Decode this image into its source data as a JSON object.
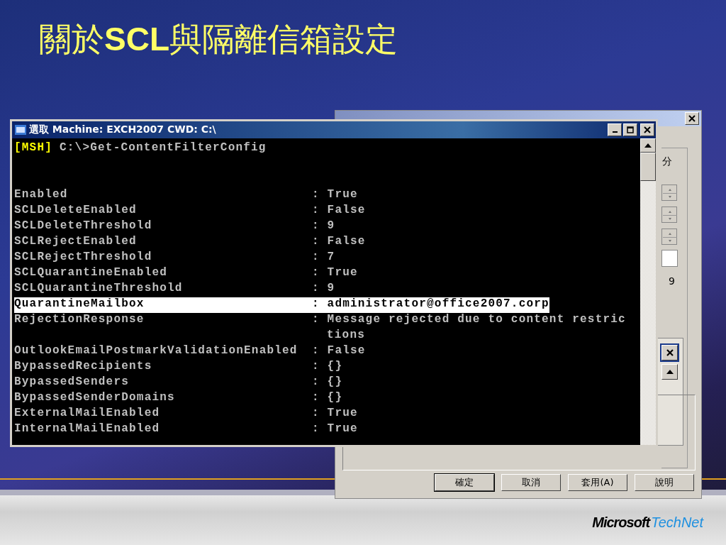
{
  "slide": {
    "title": "關於**SCL**與隔離信箱設定"
  },
  "dialog": {
    "fragments": [
      "分",
      "9"
    ],
    "buttons": [
      {
        "label": "確定",
        "default": true
      },
      {
        "label": "取消",
        "default": false
      },
      {
        "label": "套用(A)",
        "default": false
      },
      {
        "label": "說明",
        "default": false
      }
    ]
  },
  "console": {
    "title": "選取 Machine: EXCH2007 CWD: C:\\",
    "prompt": "[MSH]",
    "command": "C:\\>Get-ContentFilterConfig",
    "rows": [
      {
        "kind": "pair",
        "name": "Enabled",
        "value": ": True",
        "selected": false
      },
      {
        "kind": "pair",
        "name": "SCLDeleteEnabled",
        "value": ": False",
        "selected": false
      },
      {
        "kind": "pair",
        "name": "SCLDeleteThreshold",
        "value": ": 9",
        "selected": false
      },
      {
        "kind": "pair",
        "name": "SCLRejectEnabled",
        "value": ": False",
        "selected": false
      },
      {
        "kind": "pair",
        "name": "SCLRejectThreshold",
        "value": ": 7",
        "selected": false
      },
      {
        "kind": "pair",
        "name": "SCLQuarantineEnabled",
        "value": ": True",
        "selected": false
      },
      {
        "kind": "pair",
        "name": "SCLQuarantineThreshold",
        "value": ": 9",
        "selected": false
      },
      {
        "kind": "pair",
        "name": "QuarantineMailbox",
        "value": ": administrator@office2007.corp",
        "selected": true
      },
      {
        "kind": "pair",
        "name": "RejectionResponse",
        "value": ": Message rejected due to content restric",
        "selected": false
      },
      {
        "kind": "wrap",
        "value": "tions",
        "selected": false
      },
      {
        "kind": "pair",
        "name": "OutlookEmailPostmarkValidationEnabled",
        "value": ": False",
        "selected": false
      },
      {
        "kind": "pair",
        "name": "BypassedRecipients",
        "value": ": {}",
        "selected": false
      },
      {
        "kind": "pair",
        "name": "BypassedSenders",
        "value": ": {}",
        "selected": false
      },
      {
        "kind": "pair",
        "name": "BypassedSenderDomains",
        "value": ": {}",
        "selected": false
      },
      {
        "kind": "pair",
        "name": "ExternalMailEnabled",
        "value": ": True",
        "selected": false
      },
      {
        "kind": "pair",
        "name": "InternalMailEnabled",
        "value": ": True",
        "selected": false
      }
    ]
  },
  "footer": {
    "brand": "Microsoft",
    "product": "TechNet"
  }
}
